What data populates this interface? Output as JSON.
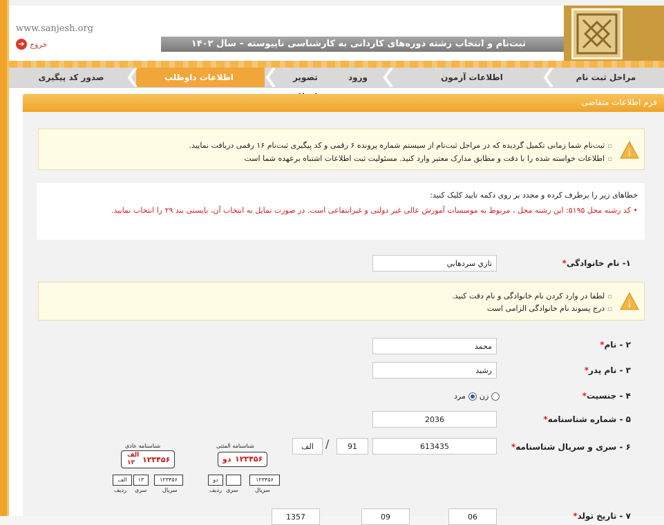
{
  "header": {
    "domain": "www.sanjesh.org",
    "exit_label": "خروج",
    "title": "ثبت‌نام و انتخاب رشته دوره‌های کاردانی به کارشناسی ناپیوسته – سال ۱۴۰۲"
  },
  "steps": [
    {
      "label": "مراحل ثبت نام",
      "active": false
    },
    {
      "label": "اطلاعات آزمون",
      "active": false
    },
    {
      "label": "ورود",
      "active": false
    },
    {
      "label": "تصویر داوطلب",
      "active": false
    },
    {
      "label": "اطلاعات داوطلب",
      "active": true
    },
    {
      "label": "صدور کد پیگیری",
      "active": false
    }
  ],
  "form": {
    "title": "فرم اطلاعات متقاضی",
    "notice1": [
      "ثبت‌نام شما زمانی تکمیل گردیده که در مراحل ثبت‌نام از سیستم شماره پرونده ۶ رقمی و کد پیگیری ثبت‌نام ۱۶ رقمی دریافت نمایید.",
      "اطلاعات خواسته شده را با دقت و مطابق مدارک معتبر وارد کنید. مسئولیت ثبت اطلاعات اشتباه برعهده شما است"
    ],
    "error_head": "خطاهای زیر را برطرف کرده و مجدد بر روی دکمه تایید کلیک کنید:",
    "error_text": "• کد رشته محل ۵۱۹۵: این رشته محل ، مربوط به موسسات آموزش عالی غیر دولتی و غیرانتفاعی است. در صورت تمایل به انتخاب آن، بایستی بند ۲۹ را انتخاب نمایید.",
    "notice2": [
      "لطفا در وارد کردن نام خانوادگی و نام دقت کنید.",
      "درج پسوند نام خانوادگی الزامی است"
    ],
    "fields": {
      "family_label": "۱- نام خانوادگی",
      "family_value": "تازي سردهايي",
      "name_label": "۲ - نام",
      "name_value": "محمد",
      "father_label": "۳ - نام پدر",
      "father_value": "رشيد",
      "gender_label": "۴ - جنسیت",
      "gender_female": "زن",
      "gender_male": "مرد",
      "gender_selected": "مرد",
      "id_number_label": "۵ - شماره شناسنامه",
      "id_number_value": "2036",
      "serial_label": "۶ - سری و سریال شناسنامه",
      "serial_value": "613435",
      "serial_no": "91",
      "serial_letter": "الف",
      "birth_label": "۷ - تاریخ تولد",
      "birth_day": "06",
      "birth_month": "09",
      "birth_year": "1357"
    },
    "samples": {
      "normal_caption": "شناسنامه عادی",
      "smart_caption": "شناسنامه المثنی",
      "number": "۱۲۳۴۵۶",
      "letter_alef": "الف",
      "num_13": "۱۳",
      "letter_do": "دو",
      "lbl_serial": "سریال",
      "lbl_series": "سری",
      "lbl_row": "ردیف",
      "lbl_serial2": "سریال"
    }
  }
}
